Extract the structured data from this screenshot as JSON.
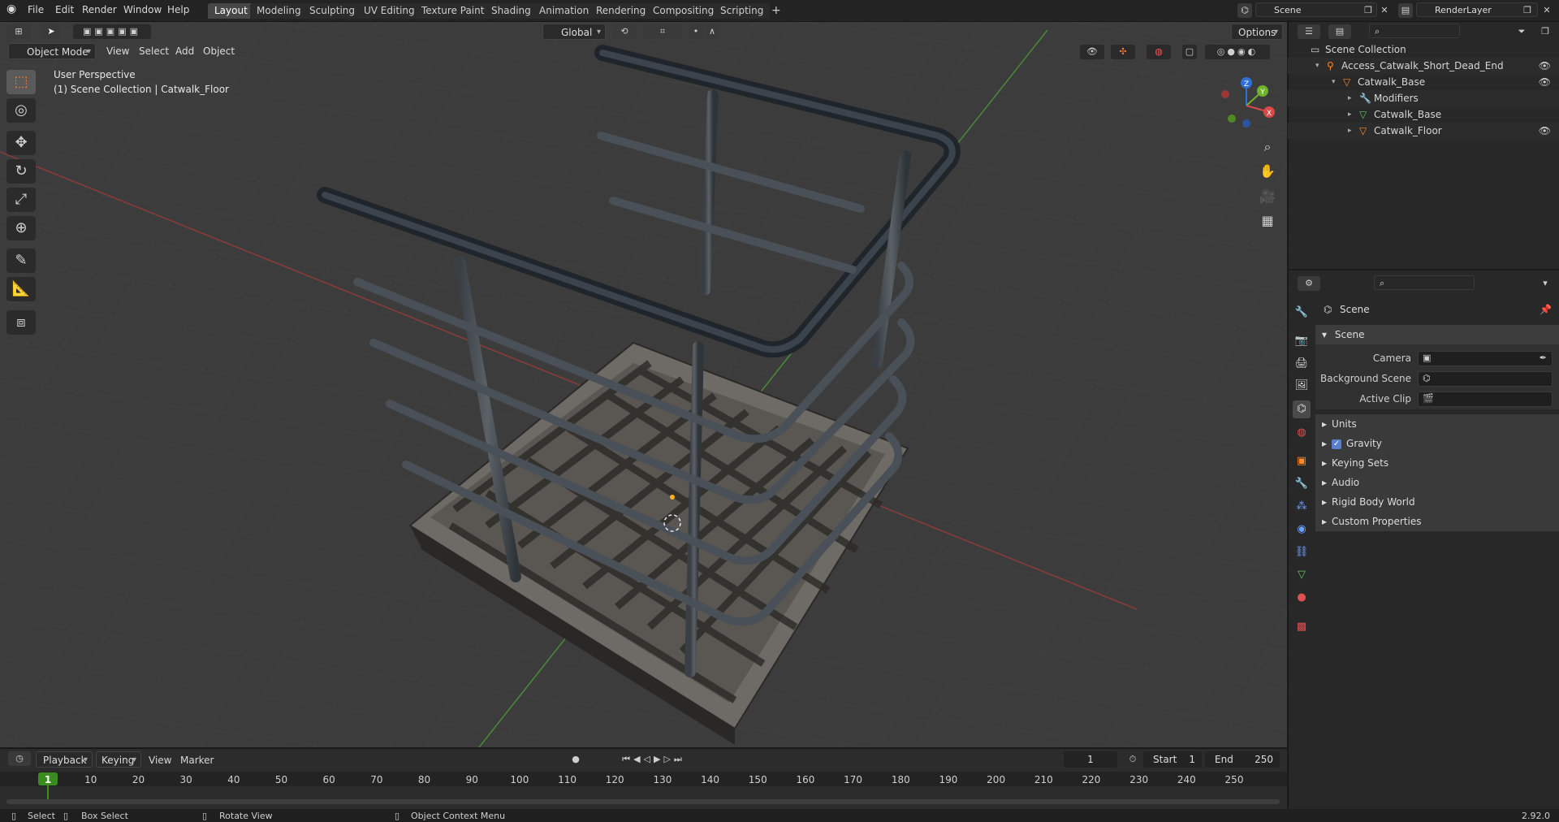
{
  "menubar": {
    "items": [
      "File",
      "Edit",
      "Render",
      "Window",
      "Help"
    ],
    "workspaces": [
      "Layout",
      "Modeling",
      "Sculpting",
      "UV Editing",
      "Texture Paint",
      "Shading",
      "Animation",
      "Rendering",
      "Compositing",
      "Scripting"
    ],
    "active_workspace": "Layout",
    "add_tab": "+",
    "scene_name": "Scene",
    "view_layer": "RenderLayer"
  },
  "viewport_header": {
    "mode": "Object Mode",
    "menus": [
      "View",
      "Select",
      "Add",
      "Object"
    ],
    "transform_orientation": "Global",
    "options": "Options"
  },
  "viewport": {
    "view_name": "User Perspective",
    "collection_info": "(1) Scene Collection | Catwalk_Floor",
    "gizmo": {
      "z": "Z",
      "y": "Y",
      "x": "X"
    }
  },
  "toolbar": {
    "tools": [
      "select-box",
      "cursor",
      "move",
      "rotate",
      "scale",
      "transform",
      "annotate",
      "measure",
      "add-cube"
    ],
    "active": "select-box"
  },
  "outliner": {
    "header_search_placeholder": "",
    "items": [
      {
        "label": "Scene Collection",
        "indent": 0,
        "icon": "collection-icon"
      },
      {
        "label": "Access_Catwalk_Short_Dead_End",
        "indent": 1,
        "icon": "armature-icon"
      },
      {
        "label": "Catwalk_Base",
        "indent": 2,
        "icon": "object-icon"
      },
      {
        "label": "Modifiers",
        "indent": 3,
        "icon": "wrench-icon"
      },
      {
        "label": "Catwalk_Base",
        "indent": 3,
        "icon": "mesh-icon"
      },
      {
        "label": "Catwalk_Floor",
        "indent": 3,
        "icon": "object-icon"
      }
    ]
  },
  "properties": {
    "context": "Scene",
    "section_scene": "Scene",
    "fields": [
      {
        "label": "Camera",
        "value": ""
      },
      {
        "label": "Background Scene",
        "value": ""
      },
      {
        "label": "Active Clip",
        "value": ""
      }
    ],
    "subsections": [
      "Units",
      "Gravity",
      "Keying Sets",
      "Audio",
      "Rigid Body World",
      "Custom Properties"
    ],
    "gravity_checked": true
  },
  "timeline": {
    "menus": [
      "Playback",
      "Keying",
      "View",
      "Marker"
    ],
    "current_frame": "1",
    "start_label": "Start",
    "start": "1",
    "end_label": "End",
    "end": "250",
    "ticks": [
      "1",
      "10",
      "20",
      "30",
      "40",
      "50",
      "60",
      "70",
      "80",
      "90",
      "100",
      "110",
      "120",
      "130",
      "140",
      "150",
      "160",
      "170",
      "180",
      "190",
      "200",
      "210",
      "220",
      "230",
      "240",
      "250"
    ]
  },
  "statusbar": {
    "select": "Select",
    "box_select": "Box Select",
    "rotate_view": "Rotate View",
    "context_menu": "Object Context Menu",
    "version": "2.92.0"
  },
  "colors": {
    "accent": "#ff7a2a",
    "selected_row": "#334d80",
    "viewport_bg": "#3c3c3c"
  }
}
